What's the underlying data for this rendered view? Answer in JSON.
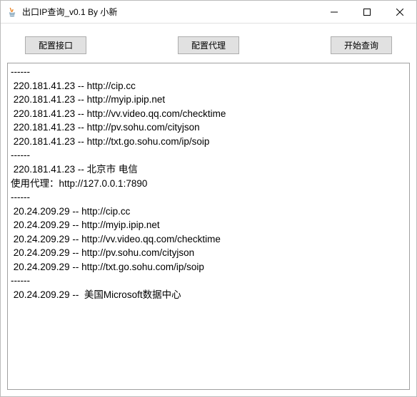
{
  "window": {
    "title": "出口IP查询_v0.1 By 小新"
  },
  "buttons": {
    "config_api": "配置接口",
    "config_proxy": "配置代理",
    "start_query": "开始查询"
  },
  "output": {
    "lines": [
      "------",
      " 220.181.41.23 -- http://cip.cc",
      " 220.181.41.23 -- http://myip.ipip.net",
      " 220.181.41.23 -- http://vv.video.qq.com/checktime",
      " 220.181.41.23 -- http://pv.sohu.com/cityjson",
      " 220.181.41.23 -- http://txt.go.sohu.com/ip/soip",
      "------",
      " 220.181.41.23 -- 北京市 电信",
      "使用代理：http://127.0.0.1:7890",
      "------",
      " 20.24.209.29 -- http://cip.cc",
      " 20.24.209.29 -- http://myip.ipip.net",
      " 20.24.209.29 -- http://vv.video.qq.com/checktime",
      " 20.24.209.29 -- http://pv.sohu.com/cityjson",
      " 20.24.209.29 -- http://txt.go.sohu.com/ip/soip",
      "------",
      " 20.24.209.29 --  美国Microsoft数据中心"
    ]
  }
}
